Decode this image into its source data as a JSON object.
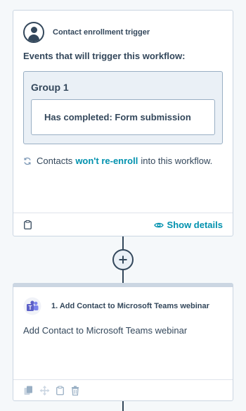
{
  "trigger": {
    "title": "Contact enrollment trigger",
    "events_label": "Events that will trigger this workflow:",
    "group_title": "Group 1",
    "filter_text": "Has completed: Form submission",
    "reenroll_prefix": "Contacts",
    "reenroll_link": "won't re-enroll",
    "reenroll_suffix": "into this workflow.",
    "show_details_label": "Show details"
  },
  "action": {
    "title": "1. Add Contact to Microsoft Teams webinar",
    "description": "Add Contact to Microsoft Teams webinar"
  },
  "icons": {
    "trigger_icon": "contact-avatar-icon",
    "refresh": "refresh-icon",
    "clipboard": "clipboard-icon",
    "eye": "eye-icon",
    "plus": "plus-icon",
    "teams": "microsoft-teams-icon",
    "copy": "copy-icon",
    "move": "move-icon",
    "delete": "trash-icon"
  },
  "colors": {
    "text": "#33475b",
    "link": "#0091ae",
    "teams_purple": "#5b5fc7",
    "border": "#cbd6e2"
  }
}
